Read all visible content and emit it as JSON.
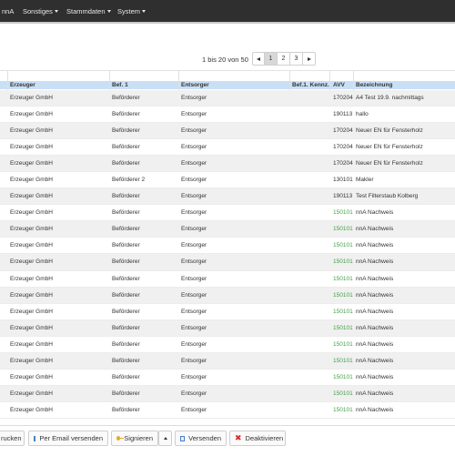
{
  "nav": {
    "items": [
      {
        "label": "nnA",
        "dropdown": false
      },
      {
        "label": "Sonstiges",
        "dropdown": true
      },
      {
        "label": "Stammdaten",
        "dropdown": true
      },
      {
        "label": "System",
        "dropdown": true
      }
    ]
  },
  "pagination": {
    "info": "1 bis 20 von 50",
    "pages": [
      "1",
      "2",
      "3"
    ],
    "current_page": "1"
  },
  "table": {
    "headers": [
      "Erzeuger",
      "Bef. 1",
      "Entsorger",
      "Bef.1. Kennz.",
      "AVV",
      "Bezeichnung"
    ],
    "rows": [
      {
        "erzeuger": "Erzeuger GmbH",
        "bef1": "Beförderer",
        "entsorger": "Entsorger",
        "kennz": "",
        "avv": "170204",
        "avv_green": false,
        "bez": "A4 Test 19.9. nachmittags"
      },
      {
        "erzeuger": "Erzeuger GmbH",
        "bef1": "Beförderer",
        "entsorger": "Entsorger",
        "kennz": "",
        "avv": "190113",
        "avv_green": false,
        "bez": "hallo"
      },
      {
        "erzeuger": "Erzeuger GmbH",
        "bef1": "Beförderer",
        "entsorger": "Entsorger",
        "kennz": "",
        "avv": "170204",
        "avv_green": false,
        "bez": "Neuer EN für Fensterholz"
      },
      {
        "erzeuger": "Erzeuger GmbH",
        "bef1": "Beförderer",
        "entsorger": "Entsorger",
        "kennz": "",
        "avv": "170204",
        "avv_green": false,
        "bez": "Neuer EN für Fensterholz"
      },
      {
        "erzeuger": "Erzeuger GmbH",
        "bef1": "Beförderer",
        "entsorger": "Entsorger",
        "kennz": "",
        "avv": "170204",
        "avv_green": false,
        "bez": "Neuer EN für Fensterholz"
      },
      {
        "erzeuger": "Erzeuger GmbH",
        "bef1": "Beförderer 2",
        "entsorger": "Entsorger",
        "kennz": "",
        "avv": "130101",
        "avv_green": false,
        "bez": "Makler"
      },
      {
        "erzeuger": "Erzeuger GmbH",
        "bef1": "Beförderer",
        "entsorger": "Entsorger",
        "kennz": "",
        "avv": "190113",
        "avv_green": false,
        "bez": "Test Filterstaub Kolberg"
      },
      {
        "erzeuger": "Erzeuger GmbH",
        "bef1": "Beförderer",
        "entsorger": "Entsorger",
        "kennz": "",
        "avv": "150101",
        "avv_green": true,
        "bez": "nnA Nachweis"
      },
      {
        "erzeuger": "Erzeuger GmbH",
        "bef1": "Beförderer",
        "entsorger": "Entsorger",
        "kennz": "",
        "avv": "150101",
        "avv_green": true,
        "bez": "nnA Nachweis"
      },
      {
        "erzeuger": "Erzeuger GmbH",
        "bef1": "Beförderer",
        "entsorger": "Entsorger",
        "kennz": "",
        "avv": "150101",
        "avv_green": true,
        "bez": "nnA Nachweis"
      },
      {
        "erzeuger": "Erzeuger GmbH",
        "bef1": "Beförderer",
        "entsorger": "Entsorger",
        "kennz": "",
        "avv": "150101",
        "avv_green": true,
        "bez": "nnA Nachweis"
      },
      {
        "erzeuger": "Erzeuger GmbH",
        "bef1": "Beförderer",
        "entsorger": "Entsorger",
        "kennz": "",
        "avv": "150101",
        "avv_green": true,
        "bez": "nnA Nachweis"
      },
      {
        "erzeuger": "Erzeuger GmbH",
        "bef1": "Beförderer",
        "entsorger": "Entsorger",
        "kennz": "",
        "avv": "150101",
        "avv_green": true,
        "bez": "nnA Nachweis"
      },
      {
        "erzeuger": "Erzeuger GmbH",
        "bef1": "Beförderer",
        "entsorger": "Entsorger",
        "kennz": "",
        "avv": "150101",
        "avv_green": true,
        "bez": "nnA Nachweis"
      },
      {
        "erzeuger": "Erzeuger GmbH",
        "bef1": "Beförderer",
        "entsorger": "Entsorger",
        "kennz": "",
        "avv": "150101",
        "avv_green": true,
        "bez": "nnA Nachweis"
      },
      {
        "erzeuger": "Erzeuger GmbH",
        "bef1": "Beförderer",
        "entsorger": "Entsorger",
        "kennz": "",
        "avv": "150101",
        "avv_green": true,
        "bez": "nnA Nachweis"
      },
      {
        "erzeuger": "Erzeuger GmbH",
        "bef1": "Beförderer",
        "entsorger": "Entsorger",
        "kennz": "",
        "avv": "150101",
        "avv_green": true,
        "bez": "nnA Nachweis"
      },
      {
        "erzeuger": "Erzeuger GmbH",
        "bef1": "Beförderer",
        "entsorger": "Entsorger",
        "kennz": "",
        "avv": "150101",
        "avv_green": true,
        "bez": "nnA Nachweis"
      },
      {
        "erzeuger": "Erzeuger GmbH",
        "bef1": "Beförderer",
        "entsorger": "Entsorger",
        "kennz": "",
        "avv": "150101",
        "avv_green": true,
        "bez": "nnA Nachweis"
      },
      {
        "erzeuger": "Erzeuger GmbH",
        "bef1": "Beförderer",
        "entsorger": "Entsorger",
        "kennz": "",
        "avv": "150101",
        "avv_green": true,
        "bez": "nnA Nachweis"
      }
    ]
  },
  "toolbar": {
    "print_label": "rucken",
    "email_label": "Per Email versenden",
    "sign_label": "Signieren",
    "send_label": "Versenden",
    "deactivate_label": "Deaktivieren",
    "icons": {
      "email": "mail-icon",
      "sign": "key-icon",
      "send": "mail-icon",
      "deactivate": "close-icon",
      "sign_menu": "caret-up-icon"
    }
  },
  "colors": {
    "navbar": "#2f2f2f",
    "header_strip": "#c9dff5",
    "row_alt": "#f0f0f0",
    "avv_green": "#43a047",
    "deactivate_red": "#d32f2f"
  }
}
